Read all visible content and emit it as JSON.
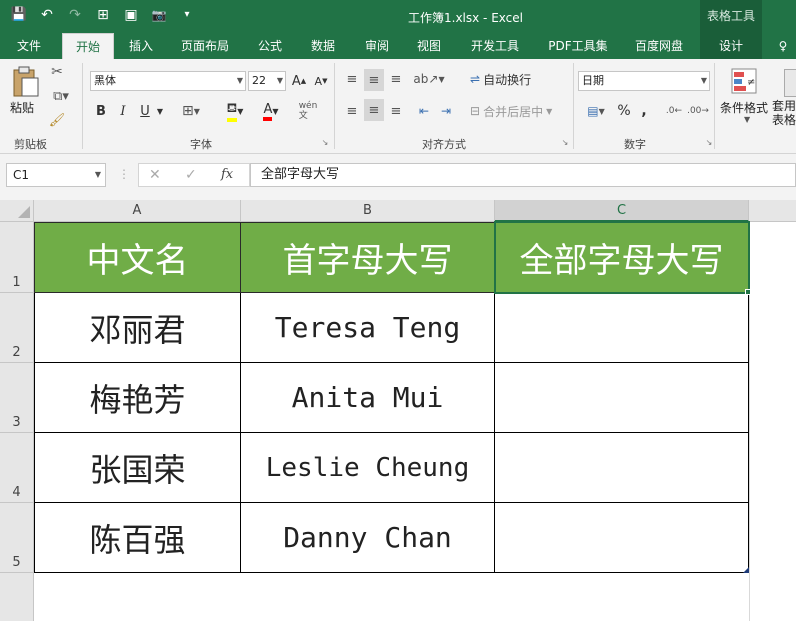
{
  "window": {
    "title": "工作簿1.xlsx - Excel",
    "context_tab": "表格工具"
  },
  "qat": {
    "save": "💾",
    "undo": "↶",
    "redo": "↷",
    "icon1": "⊞",
    "icon2": "▣",
    "camera": "📷",
    "more": "▾"
  },
  "tabs": [
    "文件",
    "开始",
    "插入",
    "页面布局",
    "公式",
    "数据",
    "审阅",
    "视图",
    "开发工具",
    "PDF工具集",
    "百度网盘",
    "设计",
    "♀"
  ],
  "ribbon": {
    "clipboard": {
      "label": "剪贴板",
      "paste": "粘贴"
    },
    "font": {
      "label": "字体",
      "name": "黑体",
      "size": "22",
      "bold": "B",
      "italic": "I",
      "underline": "U",
      "grow": "A",
      "shrink": "A"
    },
    "alignment": {
      "label": "对齐方式",
      "wrap": "自动换行",
      "merge": "合并后居中"
    },
    "number": {
      "label": "数字",
      "format": "日期",
      "percent": "%",
      "comma": ","
    },
    "styles": {
      "cond": "条件格式",
      "table": "套用\n表格"
    }
  },
  "formula": {
    "namebox": "C1",
    "value": "全部字母大写",
    "cancel": "✕",
    "enter": "✓",
    "fx": "fx"
  },
  "columns": [
    "A",
    "B",
    "C"
  ],
  "rows": [
    "1",
    "2",
    "3",
    "4",
    "5"
  ],
  "sheet": {
    "headers": [
      "中文名",
      "首字母大写",
      "全部字母大写"
    ],
    "data": [
      [
        "邓丽君",
        "Teresa Teng",
        ""
      ],
      [
        "梅艳芳",
        "Anita Mui",
        ""
      ],
      [
        "张国荣",
        "Leslie Cheung",
        ""
      ],
      [
        "陈百强",
        "Danny Chan",
        ""
      ]
    ]
  },
  "colors": {
    "excel_green": "#217346",
    "header_fill": "#70ad47"
  }
}
